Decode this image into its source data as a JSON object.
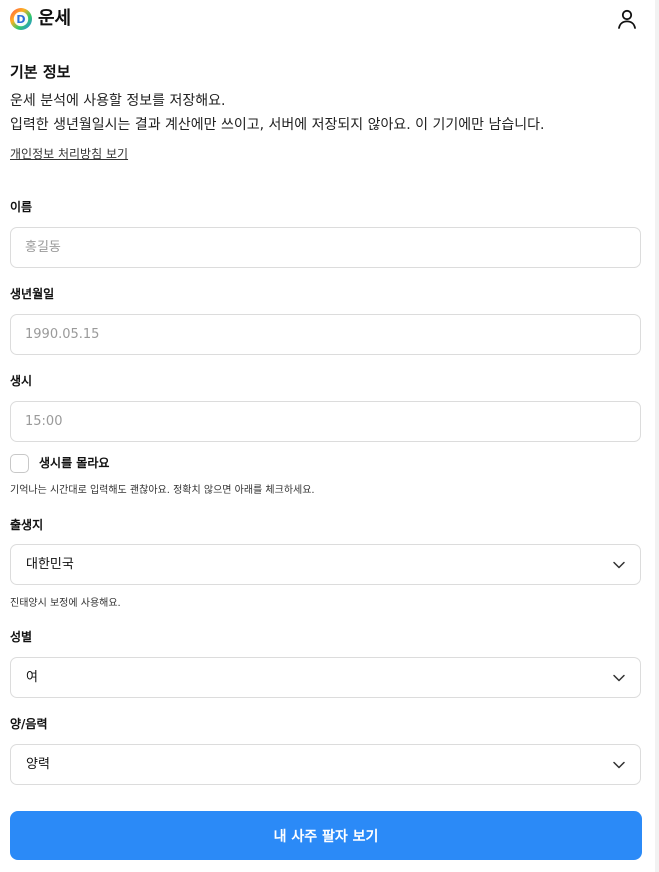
{
  "header": {
    "logo_letter": "D",
    "title": "운세",
    "user_icon": "user-icon"
  },
  "intro": {
    "title": "기본 정보",
    "line1": "운세 분석에 사용할 정보를 저장해요.",
    "line2": "입력한 생년월일시는 결과 계산에만 쓰이고, 서버에 저장되지 않아요. 이 기기에만 남습니다.",
    "privacy_link": "개인정보 처리방침 보기"
  },
  "form": {
    "name": {
      "label": "이름",
      "value": "",
      "placeholder": "홍길동"
    },
    "birthdate": {
      "label": "생년월일",
      "value": "",
      "placeholder": "1990.05.15"
    },
    "birthtime": {
      "label": "생시",
      "value": "",
      "placeholder": "15:00"
    },
    "unknown_time": {
      "label": "생시를 몰라요",
      "checked": false
    },
    "time_help": "기억나는 시간대로 입력해도 괜찮아요. 정확치 않으면 아래를 체크하세요.",
    "birthplace": {
      "label": "출생지",
      "value": "대한민국"
    },
    "birthplace_help": "진태양시 보정에 사용해요.",
    "gender": {
      "label": "성별",
      "value": "여"
    },
    "calendar": {
      "label": "양/음력",
      "value": "양력"
    }
  },
  "submit_label": "내 사주 팔자 보기",
  "colors": {
    "accent": "#2b8af7",
    "border": "#dcdcdc",
    "placeholder": "#9a9a9a"
  }
}
